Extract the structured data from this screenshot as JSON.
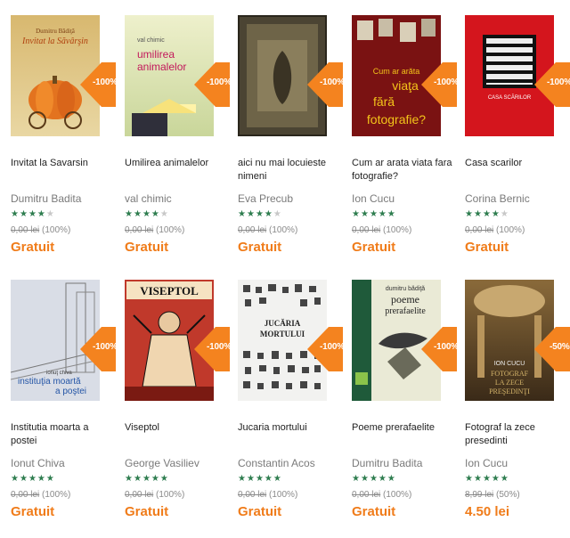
{
  "colors": {
    "accent": "#f07c1a",
    "star": "#2e7d4f",
    "badge": "#f4831f"
  },
  "books": [
    {
      "title": "Invitat la Savarsin",
      "author": "Dumitru Badita",
      "rating": 4,
      "old_price": "0,00 lei",
      "discount_pct": "(100%)",
      "new_price": "Gratuit",
      "badge": "-100%",
      "cover_text": [
        "Dumitru Bădiţă",
        "Invitat la Săvârşin"
      ]
    },
    {
      "title": "Umilirea animalelor",
      "author": "val chimic",
      "rating": 4,
      "old_price": "0,00 lei",
      "discount_pct": "(100%)",
      "new_price": "Gratuit",
      "badge": "-100%",
      "cover_text": [
        "val chimic",
        "umilirea",
        "animalelor"
      ]
    },
    {
      "title": "aici nu mai locuieste nimeni",
      "author": "Eva Precub",
      "rating": 4,
      "old_price": "0,00 lei",
      "discount_pct": "(100%)",
      "new_price": "Gratuit",
      "badge": "-100%",
      "cover_text": []
    },
    {
      "title": "Cum ar arata viata fara fotografie?",
      "author": "Ion Cucu",
      "rating": 5,
      "old_price": "0,00 lei",
      "discount_pct": "(100%)",
      "new_price": "Gratuit",
      "badge": "-100%",
      "cover_text": [
        "Cum ar arăta",
        "viaţa",
        "fără",
        "fotografie?"
      ]
    },
    {
      "title": "Casa scarilor",
      "author": "Corina Bernic",
      "rating": 4,
      "old_price": "0,00 lei",
      "discount_pct": "(100%)",
      "new_price": "Gratuit",
      "badge": "-100%",
      "cover_text": [
        "CASA SCĂRILOR"
      ]
    },
    {
      "title": "Institutia moarta a postei",
      "author": "Ionut Chiva",
      "rating": 5,
      "old_price": "0,00 lei",
      "discount_pct": "(100%)",
      "new_price": "Gratuit",
      "badge": "-100%",
      "cover_text": [
        "ionuţ chiva",
        "instituţia moartă",
        "a poştei"
      ]
    },
    {
      "title": "Viseptol",
      "author": "George Vasiliev",
      "rating": 5,
      "old_price": "0,00 lei",
      "discount_pct": "(100%)",
      "new_price": "Gratuit",
      "badge": "-100%",
      "cover_text": [
        "VISEPTOL"
      ]
    },
    {
      "title": "Jucaria mortului",
      "author": "Constantin Acos",
      "rating": 5,
      "old_price": "0,00 lei",
      "discount_pct": "(100%)",
      "new_price": "Gratuit",
      "badge": "-100%",
      "cover_text": [
        "JUCĂRIA",
        "MORTULUI"
      ]
    },
    {
      "title": "Poeme prerafaelite",
      "author": "Dumitru Badita",
      "rating": 5,
      "old_price": "0,00 lei",
      "discount_pct": "(100%)",
      "new_price": "Gratuit",
      "badge": "-100%",
      "cover_text": [
        "dumitru bădiţă",
        "poeme",
        "prerafaelite"
      ]
    },
    {
      "title": "Fotograf la zece presedinti",
      "author": "Ion Cucu",
      "rating": 5,
      "old_price": "8,99 lei",
      "discount_pct": "(50%)",
      "new_price": "4.50 lei",
      "badge": "-50%",
      "cover_text": [
        "ION CUCU",
        "FOTOGRAF",
        "LA ZECE",
        "PREŞEDINŢI"
      ]
    }
  ]
}
